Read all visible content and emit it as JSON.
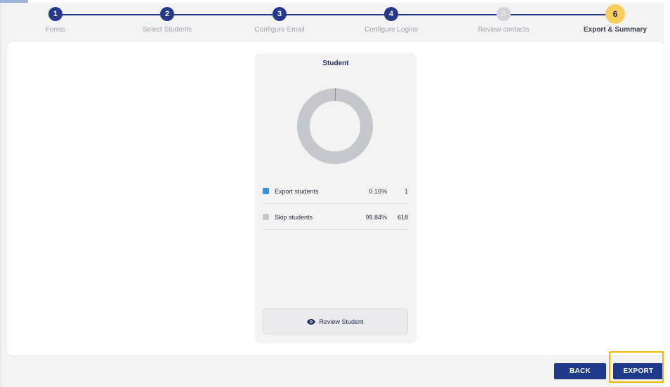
{
  "stepper": {
    "steps": [
      {
        "number": "1",
        "label": "Forms",
        "state": "completed"
      },
      {
        "number": "2",
        "label": "Select Students",
        "state": "completed"
      },
      {
        "number": "3",
        "label": "Configure Email",
        "state": "completed"
      },
      {
        "number": "4",
        "label": "Configure Logins",
        "state": "completed"
      },
      {
        "number": "5",
        "label": "Review contacts",
        "state": "inactive"
      },
      {
        "number": "6",
        "label": "Export & Summary",
        "state": "active"
      }
    ]
  },
  "card": {
    "title": "Student",
    "legend": [
      {
        "label": "Export students",
        "percent": "0.16%",
        "count": "1",
        "color": "#3b8fd0"
      },
      {
        "label": "Skip students",
        "percent": "99.84%",
        "count": "618",
        "color": "#c4c7cc"
      }
    ],
    "review_button": {
      "label": "Review Student",
      "icon": "eye-icon"
    }
  },
  "footer": {
    "back_label": "BACK",
    "export_label": "EXPORT"
  },
  "colors": {
    "primary": "#1f3a8a",
    "active_step": "#f8cd5e",
    "highlight": "#f2b705"
  }
}
